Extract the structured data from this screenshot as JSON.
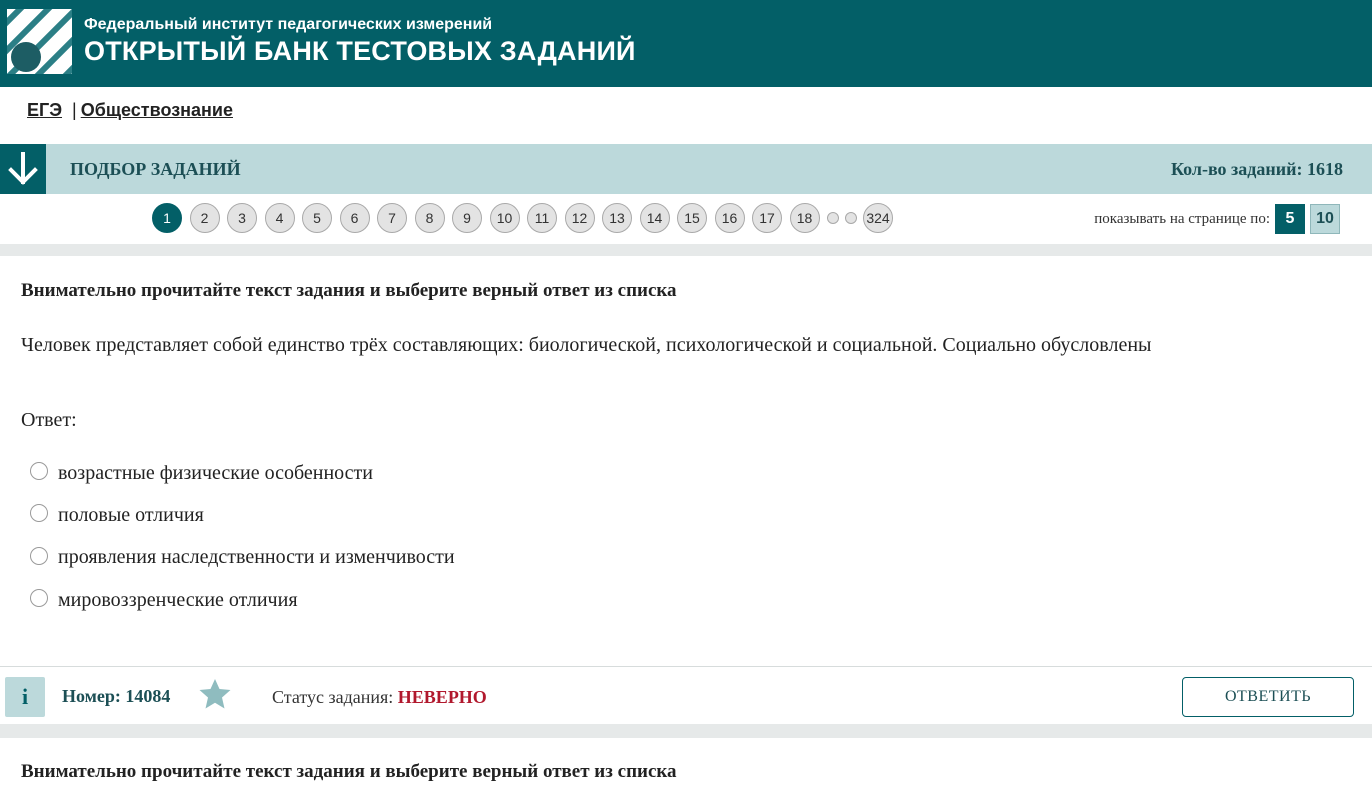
{
  "header": {
    "org": "Федеральный институт педагогических измерений",
    "title": "ОТКРЫТЫЙ БАНК ТЕСТОВЫХ ЗАДАНИЙ"
  },
  "breadcrumb": {
    "exam": "ЕГЭ",
    "separator": "|",
    "subject": "Обществознание"
  },
  "selection": {
    "title": "ПОДБОР ЗАДАНИЙ",
    "count": "Кол-во заданий: 1618"
  },
  "pagination": {
    "pages": [
      "1",
      "2",
      "3",
      "4",
      "5",
      "6",
      "7",
      "8",
      "9",
      "10",
      "11",
      "12",
      "13",
      "14",
      "15",
      "16",
      "17",
      "18"
    ],
    "active": "1",
    "last": "324",
    "per_page_label": "показывать на странице по:",
    "per_page_options": [
      "5",
      "10"
    ],
    "per_page_selected": "5"
  },
  "task1": {
    "instruction": "Внимательно прочитайте текст задания и выберите верный ответ из списка",
    "text": "Человек представляет собой единство трёх составляющих: биологической, психологической и социальной. Социально обусловлены",
    "answer_label": "Ответ:",
    "options": [
      "возрастные физические особенности",
      "половые отличия",
      "проявления наследственности и изменчивости",
      "мировоззренческие отличия"
    ],
    "info": "i",
    "number_label": "Номер: 14084",
    "status_label": "Статус задания:",
    "status_value": "НЕВЕРНО",
    "answer_button": "ОТВЕТИТЬ"
  },
  "task2": {
    "instruction": "Внимательно прочитайте текст задания и выберите верный ответ из списка"
  },
  "colors": {
    "primary": "#035f67",
    "light": "#bcd9db",
    "error": "#b1182d"
  }
}
